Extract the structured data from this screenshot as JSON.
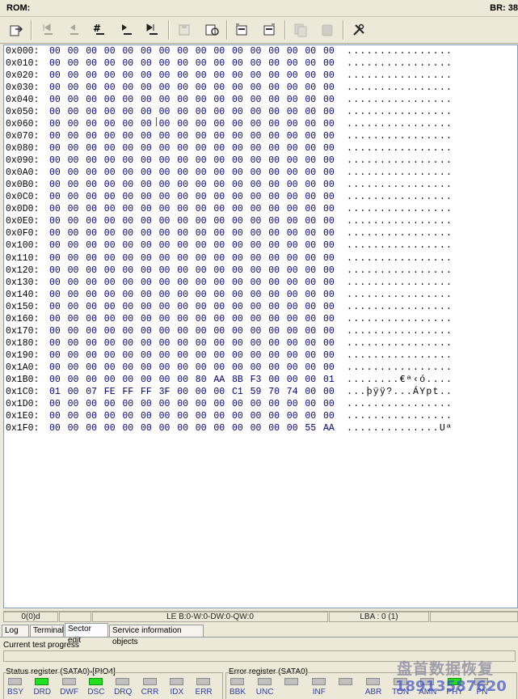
{
  "titlebar": {
    "rom_label": "ROM:",
    "br_label": "BR: 38"
  },
  "toolbar": {
    "buttons": [
      {
        "icon": "open-icon",
        "enabled": true
      },
      {
        "icon": "first-sector-icon",
        "enabled": false
      },
      {
        "icon": "prev-sector-icon",
        "enabled": false
      },
      {
        "icon": "goto-sector-icon",
        "enabled": true
      },
      {
        "icon": "next-sector-icon",
        "enabled": true
      },
      {
        "icon": "last-sector-icon",
        "enabled": true
      },
      {
        "icon": "save-icon",
        "enabled": false
      },
      {
        "icon": "save-as-icon",
        "enabled": true
      },
      {
        "icon": "read-sector-icon",
        "enabled": true
      },
      {
        "icon": "write-sector-icon",
        "enabled": true
      },
      {
        "icon": "copy-icon",
        "enabled": false
      },
      {
        "icon": "paste-icon",
        "enabled": false
      },
      {
        "icon": "tools-icon",
        "enabled": true
      }
    ]
  },
  "hex": {
    "rows": [
      {
        "addr": "0x000:",
        "bytes": [
          "00",
          "00",
          "00",
          "00",
          "00",
          "00",
          "00",
          "00",
          "00",
          "00",
          "00",
          "00",
          "00",
          "00",
          "00",
          "00"
        ],
        "ascii": "................"
      },
      {
        "addr": "0x010:",
        "bytes": [
          "00",
          "00",
          "00",
          "00",
          "00",
          "00",
          "00",
          "00",
          "00",
          "00",
          "00",
          "00",
          "00",
          "00",
          "00",
          "00"
        ],
        "ascii": "................"
      },
      {
        "addr": "0x020:",
        "bytes": [
          "00",
          "00",
          "00",
          "00",
          "00",
          "00",
          "00",
          "00",
          "00",
          "00",
          "00",
          "00",
          "00",
          "00",
          "00",
          "00"
        ],
        "ascii": "................"
      },
      {
        "addr": "0x030:",
        "bytes": [
          "00",
          "00",
          "00",
          "00",
          "00",
          "00",
          "00",
          "00",
          "00",
          "00",
          "00",
          "00",
          "00",
          "00",
          "00",
          "00"
        ],
        "ascii": "................"
      },
      {
        "addr": "0x040:",
        "bytes": [
          "00",
          "00",
          "00",
          "00",
          "00",
          "00",
          "00",
          "00",
          "00",
          "00",
          "00",
          "00",
          "00",
          "00",
          "00",
          "00"
        ],
        "ascii": "................"
      },
      {
        "addr": "0x050:",
        "bytes": [
          "00",
          "00",
          "00",
          "00",
          "00",
          "00",
          "00",
          "00",
          "00",
          "00",
          "00",
          "00",
          "00",
          "00",
          "00",
          "00"
        ],
        "ascii": "................"
      },
      {
        "addr": "0x060:",
        "bytes": [
          "00",
          "00",
          "00",
          "00",
          "00",
          "00",
          "00",
          "00",
          "00",
          "00",
          "00",
          "00",
          "00",
          "00",
          "00",
          "00"
        ],
        "ascii": "................"
      },
      {
        "addr": "0x070:",
        "bytes": [
          "00",
          "00",
          "00",
          "00",
          "00",
          "00",
          "00",
          "00",
          "00",
          "00",
          "00",
          "00",
          "00",
          "00",
          "00",
          "00"
        ],
        "ascii": "................"
      },
      {
        "addr": "0x080:",
        "bytes": [
          "00",
          "00",
          "00",
          "00",
          "00",
          "00",
          "00",
          "00",
          "00",
          "00",
          "00",
          "00",
          "00",
          "00",
          "00",
          "00"
        ],
        "ascii": "................"
      },
      {
        "addr": "0x090:",
        "bytes": [
          "00",
          "00",
          "00",
          "00",
          "00",
          "00",
          "00",
          "00",
          "00",
          "00",
          "00",
          "00",
          "00",
          "00",
          "00",
          "00"
        ],
        "ascii": "................"
      },
      {
        "addr": "0x0A0:",
        "bytes": [
          "00",
          "00",
          "00",
          "00",
          "00",
          "00",
          "00",
          "00",
          "00",
          "00",
          "00",
          "00",
          "00",
          "00",
          "00",
          "00"
        ],
        "ascii": "................"
      },
      {
        "addr": "0x0B0:",
        "bytes": [
          "00",
          "00",
          "00",
          "00",
          "00",
          "00",
          "00",
          "00",
          "00",
          "00",
          "00",
          "00",
          "00",
          "00",
          "00",
          "00"
        ],
        "ascii": "................"
      },
      {
        "addr": "0x0C0:",
        "bytes": [
          "00",
          "00",
          "00",
          "00",
          "00",
          "00",
          "00",
          "00",
          "00",
          "00",
          "00",
          "00",
          "00",
          "00",
          "00",
          "00"
        ],
        "ascii": "................"
      },
      {
        "addr": "0x0D0:",
        "bytes": [
          "00",
          "00",
          "00",
          "00",
          "00",
          "00",
          "00",
          "00",
          "00",
          "00",
          "00",
          "00",
          "00",
          "00",
          "00",
          "00"
        ],
        "ascii": "................"
      },
      {
        "addr": "0x0E0:",
        "bytes": [
          "00",
          "00",
          "00",
          "00",
          "00",
          "00",
          "00",
          "00",
          "00",
          "00",
          "00",
          "00",
          "00",
          "00",
          "00",
          "00"
        ],
        "ascii": "................"
      },
      {
        "addr": "0x0F0:",
        "bytes": [
          "00",
          "00",
          "00",
          "00",
          "00",
          "00",
          "00",
          "00",
          "00",
          "00",
          "00",
          "00",
          "00",
          "00",
          "00",
          "00"
        ],
        "ascii": "................"
      },
      {
        "addr": "0x100:",
        "bytes": [
          "00",
          "00",
          "00",
          "00",
          "00",
          "00",
          "00",
          "00",
          "00",
          "00",
          "00",
          "00",
          "00",
          "00",
          "00",
          "00"
        ],
        "ascii": "................"
      },
      {
        "addr": "0x110:",
        "bytes": [
          "00",
          "00",
          "00",
          "00",
          "00",
          "00",
          "00",
          "00",
          "00",
          "00",
          "00",
          "00",
          "00",
          "00",
          "00",
          "00"
        ],
        "ascii": "................"
      },
      {
        "addr": "0x120:",
        "bytes": [
          "00",
          "00",
          "00",
          "00",
          "00",
          "00",
          "00",
          "00",
          "00",
          "00",
          "00",
          "00",
          "00",
          "00",
          "00",
          "00"
        ],
        "ascii": "................"
      },
      {
        "addr": "0x130:",
        "bytes": [
          "00",
          "00",
          "00",
          "00",
          "00",
          "00",
          "00",
          "00",
          "00",
          "00",
          "00",
          "00",
          "00",
          "00",
          "00",
          "00"
        ],
        "ascii": "................"
      },
      {
        "addr": "0x140:",
        "bytes": [
          "00",
          "00",
          "00",
          "00",
          "00",
          "00",
          "00",
          "00",
          "00",
          "00",
          "00",
          "00",
          "00",
          "00",
          "00",
          "00"
        ],
        "ascii": "................"
      },
      {
        "addr": "0x150:",
        "bytes": [
          "00",
          "00",
          "00",
          "00",
          "00",
          "00",
          "00",
          "00",
          "00",
          "00",
          "00",
          "00",
          "00",
          "00",
          "00",
          "00"
        ],
        "ascii": "................"
      },
      {
        "addr": "0x160:",
        "bytes": [
          "00",
          "00",
          "00",
          "00",
          "00",
          "00",
          "00",
          "00",
          "00",
          "00",
          "00",
          "00",
          "00",
          "00",
          "00",
          "00"
        ],
        "ascii": "................"
      },
      {
        "addr": "0x170:",
        "bytes": [
          "00",
          "00",
          "00",
          "00",
          "00",
          "00",
          "00",
          "00",
          "00",
          "00",
          "00",
          "00",
          "00",
          "00",
          "00",
          "00"
        ],
        "ascii": "................"
      },
      {
        "addr": "0x180:",
        "bytes": [
          "00",
          "00",
          "00",
          "00",
          "00",
          "00",
          "00",
          "00",
          "00",
          "00",
          "00",
          "00",
          "00",
          "00",
          "00",
          "00"
        ],
        "ascii": "................"
      },
      {
        "addr": "0x190:",
        "bytes": [
          "00",
          "00",
          "00",
          "00",
          "00",
          "00",
          "00",
          "00",
          "00",
          "00",
          "00",
          "00",
          "00",
          "00",
          "00",
          "00"
        ],
        "ascii": "................"
      },
      {
        "addr": "0x1A0:",
        "bytes": [
          "00",
          "00",
          "00",
          "00",
          "00",
          "00",
          "00",
          "00",
          "00",
          "00",
          "00",
          "00",
          "00",
          "00",
          "00",
          "00"
        ],
        "ascii": "................"
      },
      {
        "addr": "0x1B0:",
        "bytes": [
          "00",
          "00",
          "00",
          "00",
          "00",
          "00",
          "00",
          "00",
          "80",
          "AA",
          "8B",
          "F3",
          "00",
          "00",
          "00",
          "01"
        ],
        "ascii": "........€ª‹ó...."
      },
      {
        "addr": "0x1C0:",
        "bytes": [
          "01",
          "00",
          "07",
          "FE",
          "FF",
          "FF",
          "3F",
          "00",
          "00",
          "00",
          "C1",
          "59",
          "70",
          "74",
          "00",
          "00"
        ],
        "ascii": "...þÿÿ?...ÁYpt.."
      },
      {
        "addr": "0x1D0:",
        "bytes": [
          "00",
          "00",
          "00",
          "00",
          "00",
          "00",
          "00",
          "00",
          "00",
          "00",
          "00",
          "00",
          "00",
          "00",
          "00",
          "00"
        ],
        "ascii": "................"
      },
      {
        "addr": "0x1E0:",
        "bytes": [
          "00",
          "00",
          "00",
          "00",
          "00",
          "00",
          "00",
          "00",
          "00",
          "00",
          "00",
          "00",
          "00",
          "00",
          "00",
          "00"
        ],
        "ascii": "................"
      },
      {
        "addr": "0x1F0:",
        "bytes": [
          "00",
          "00",
          "00",
          "00",
          "00",
          "00",
          "00",
          "00",
          "00",
          "00",
          "00",
          "00",
          "00",
          "00",
          "55",
          "AA"
        ],
        "ascii": "..............Uª"
      }
    ]
  },
  "status": {
    "offset": "0(0)d",
    "empty1": "",
    "endian": "LE B:0-W:0-DW:0-QW:0",
    "lba": "LBA : 0 (1)",
    "empty2": ""
  },
  "tabs": [
    {
      "label": "Log",
      "active": false
    },
    {
      "label": "Terminal",
      "active": false
    },
    {
      "label": "Sector edit",
      "active": true
    },
    {
      "label": "Service information objects",
      "active": false
    }
  ],
  "progress": {
    "label": "Current test progress",
    "value": 0
  },
  "status_register": {
    "title": "Status register (SATA0)-[PIO4]",
    "leds": [
      {
        "label": "BSY",
        "on": false
      },
      {
        "label": "DRD",
        "on": true
      },
      {
        "label": "DWF",
        "on": false
      },
      {
        "label": "DSC",
        "on": true
      },
      {
        "label": "DRQ",
        "on": false
      },
      {
        "label": "CRR",
        "on": false
      },
      {
        "label": "IDX",
        "on": false
      },
      {
        "label": "ERR",
        "on": false
      }
    ]
  },
  "error_register": {
    "title": "Error register (SATA0)",
    "leds": [
      {
        "label": "BBK",
        "on": false
      },
      {
        "label": "UNC",
        "on": false
      },
      {
        "label": "",
        "on": false
      },
      {
        "label": "INF",
        "on": false
      },
      {
        "label": "",
        "on": false
      },
      {
        "label": "ABR",
        "on": false
      },
      {
        "label": "TON",
        "on": false
      },
      {
        "label": "AMN",
        "on": false
      },
      {
        "label": "PHY",
        "on": true
      },
      {
        "label": "PN",
        "on": false
      }
    ]
  },
  "watermark": {
    "line1": "盘首数据恢复",
    "line2": "18913587620"
  },
  "colors": {
    "led_on": "#20e020",
    "led_off": "#bfbfbf",
    "hex_bytes": "#00007f",
    "label_blue": "#2a3ea8"
  }
}
